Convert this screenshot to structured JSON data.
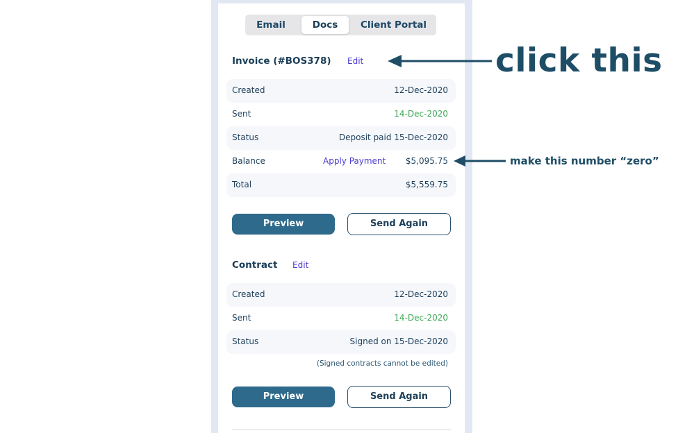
{
  "tabs": [
    {
      "label": "Email",
      "active": false
    },
    {
      "label": "Docs",
      "active": true
    },
    {
      "label": "Client Portal",
      "active": false
    }
  ],
  "invoice": {
    "title": "Invoice (#BOS378)",
    "edit_label": "Edit",
    "rows": [
      {
        "label": "Created",
        "value": "12-Dec-2020"
      },
      {
        "label": "Sent",
        "value": "14-Dec-2020"
      },
      {
        "label": "Status",
        "value": "Deposit paid 15-Dec-2020"
      },
      {
        "label": "Balance",
        "action": "Apply Payment",
        "value": "$5,095.75"
      },
      {
        "label": "Total",
        "value": "$5,559.75"
      }
    ],
    "preview_label": "Preview",
    "send_again_label": "Send Again"
  },
  "contract": {
    "title": "Contract",
    "edit_label": "Edit",
    "rows": [
      {
        "label": "Created",
        "value": "12-Dec-2020"
      },
      {
        "label": "Sent",
        "value": "14-Dec-2020"
      },
      {
        "label": "Status",
        "value": "Signed on 15-Dec-2020"
      }
    ],
    "note": "(Signed contracts cannot be edited)",
    "preview_label": "Preview",
    "send_again_label": "Send Again"
  },
  "annotations": {
    "click_this": "click this",
    "make_zero": "make this number “zero”"
  },
  "colors": {
    "primary": "#2d6a8c",
    "link": "#4a3bd0",
    "sent_green": "#3aa655",
    "annotation": "#1e4d66"
  }
}
